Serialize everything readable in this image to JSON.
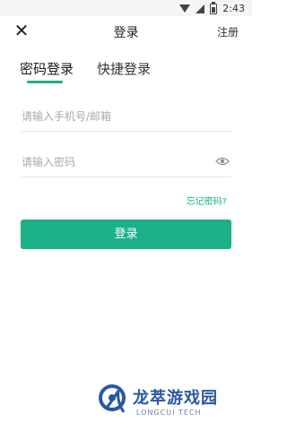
{
  "status_bar": {
    "time": "2:43"
  },
  "header": {
    "title": "登录",
    "register_label": "注册",
    "close_icon": "close-icon"
  },
  "tabs": [
    {
      "label": "密码登录",
      "active": true
    },
    {
      "label": "快捷登录",
      "active": false
    }
  ],
  "form": {
    "account_placeholder": "请输入手机号/邮箱",
    "password_placeholder": "请输入密码",
    "forgot_label": "忘记密码?",
    "submit_label": "登录"
  },
  "watermark": {
    "title": "龙萃游戏园",
    "subtitle": "LONGCUI TECH"
  },
  "colors": {
    "accent": "#1db088",
    "watermark": "#2a57a4"
  }
}
